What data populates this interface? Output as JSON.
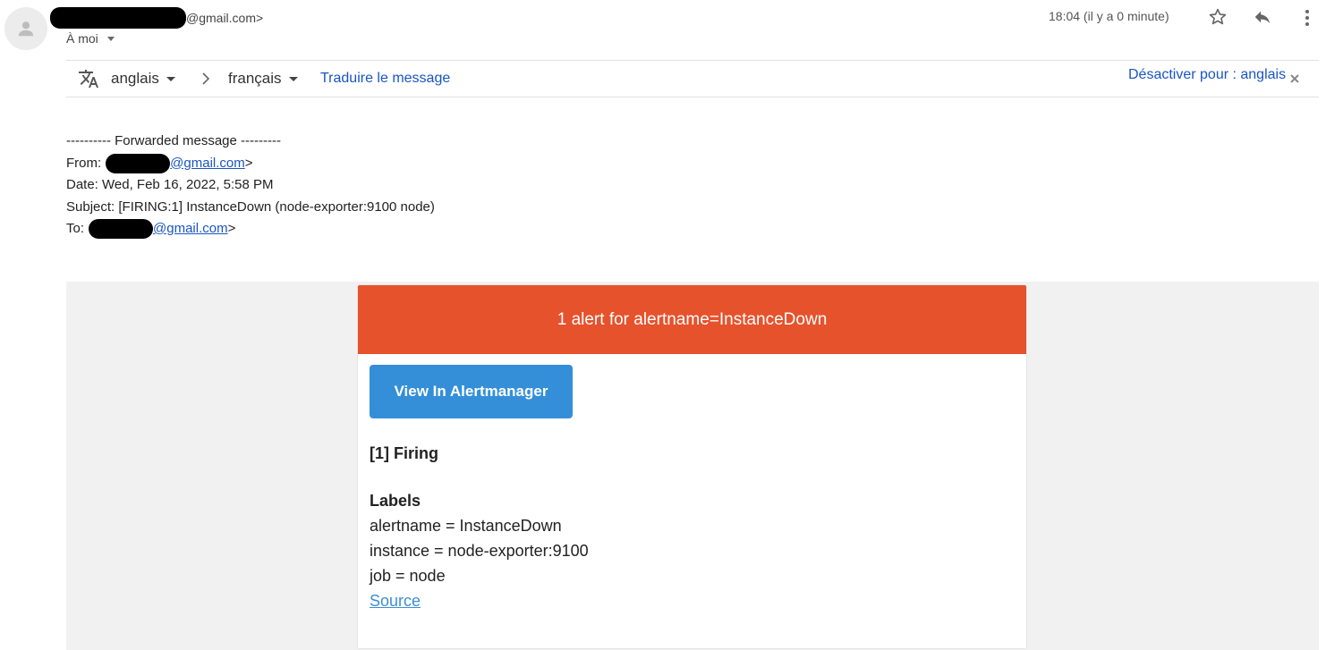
{
  "header": {
    "sender_suffix": "@gmail.com>",
    "recipient": "À moi",
    "time": "18:04 (il y a 0 minute)"
  },
  "translate": {
    "from_lang": "anglais",
    "to_lang": "français",
    "translate_link": "Traduire le message",
    "disable_link": "Désactiver pour : anglais"
  },
  "forwarded": {
    "divider": "---------- Forwarded message ---------",
    "from_label": "From:",
    "from_email_suffix": "@gmail.com",
    "date_line": "Date: Wed, Feb 16, 2022, 5:58 PM",
    "subject_line": "Subject: [FIRING:1] InstanceDown (node-exporter:9100 node)",
    "to_label": "To:",
    "to_email_suffix": "@gmail.com"
  },
  "alert": {
    "title": "1 alert for alertname=InstanceDown",
    "button": "View In Alertmanager",
    "firing": "[1] Firing",
    "labels_heading": "Labels",
    "label_lines": [
      "alertname = InstanceDown",
      "instance = node-exporter:9100",
      "job = node"
    ],
    "source_link": "Source",
    "colors": {
      "header": "#e6522c",
      "button": "#348fd8"
    }
  }
}
